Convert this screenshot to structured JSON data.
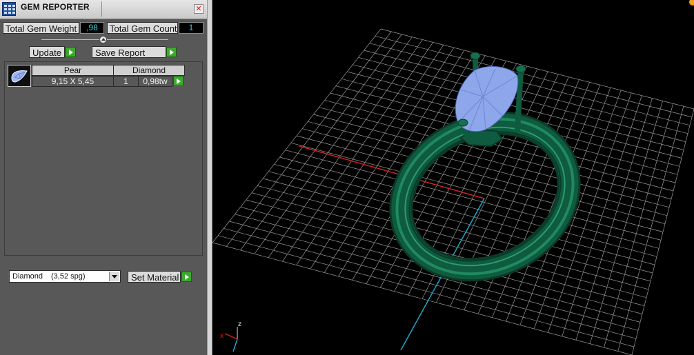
{
  "window": {
    "title": "GEM REPORTER",
    "close_glyph": "✕"
  },
  "totals": {
    "weight_label": "Total Gem Weight",
    "weight_value": ",98",
    "count_label": "Total Gem Count",
    "count_value": "1"
  },
  "actions": {
    "update_label": "Update",
    "save_report_label": "Save Report"
  },
  "gem_table": {
    "headers": [
      "Pear",
      "Diamond"
    ],
    "rows": [
      {
        "size": "9,15 X 5,45",
        "count": "1",
        "weight": "0,98tw",
        "icon": "pear-gem-icon"
      }
    ]
  },
  "material": {
    "selected_name": "Diamond",
    "selected_spg": "(3,52 spg)",
    "set_material_label": "Set Material"
  },
  "axes": {
    "x_label": "x",
    "z_label": "z"
  },
  "colors": {
    "ring_metal": "#0f5b40",
    "gem": "#8ea7ea",
    "grid": "#9a9a9a",
    "x_axis": "#d42020",
    "y_axis": "#1aa9c8",
    "go_button": "#3cab2c",
    "value_text": "#2fd5e0"
  }
}
